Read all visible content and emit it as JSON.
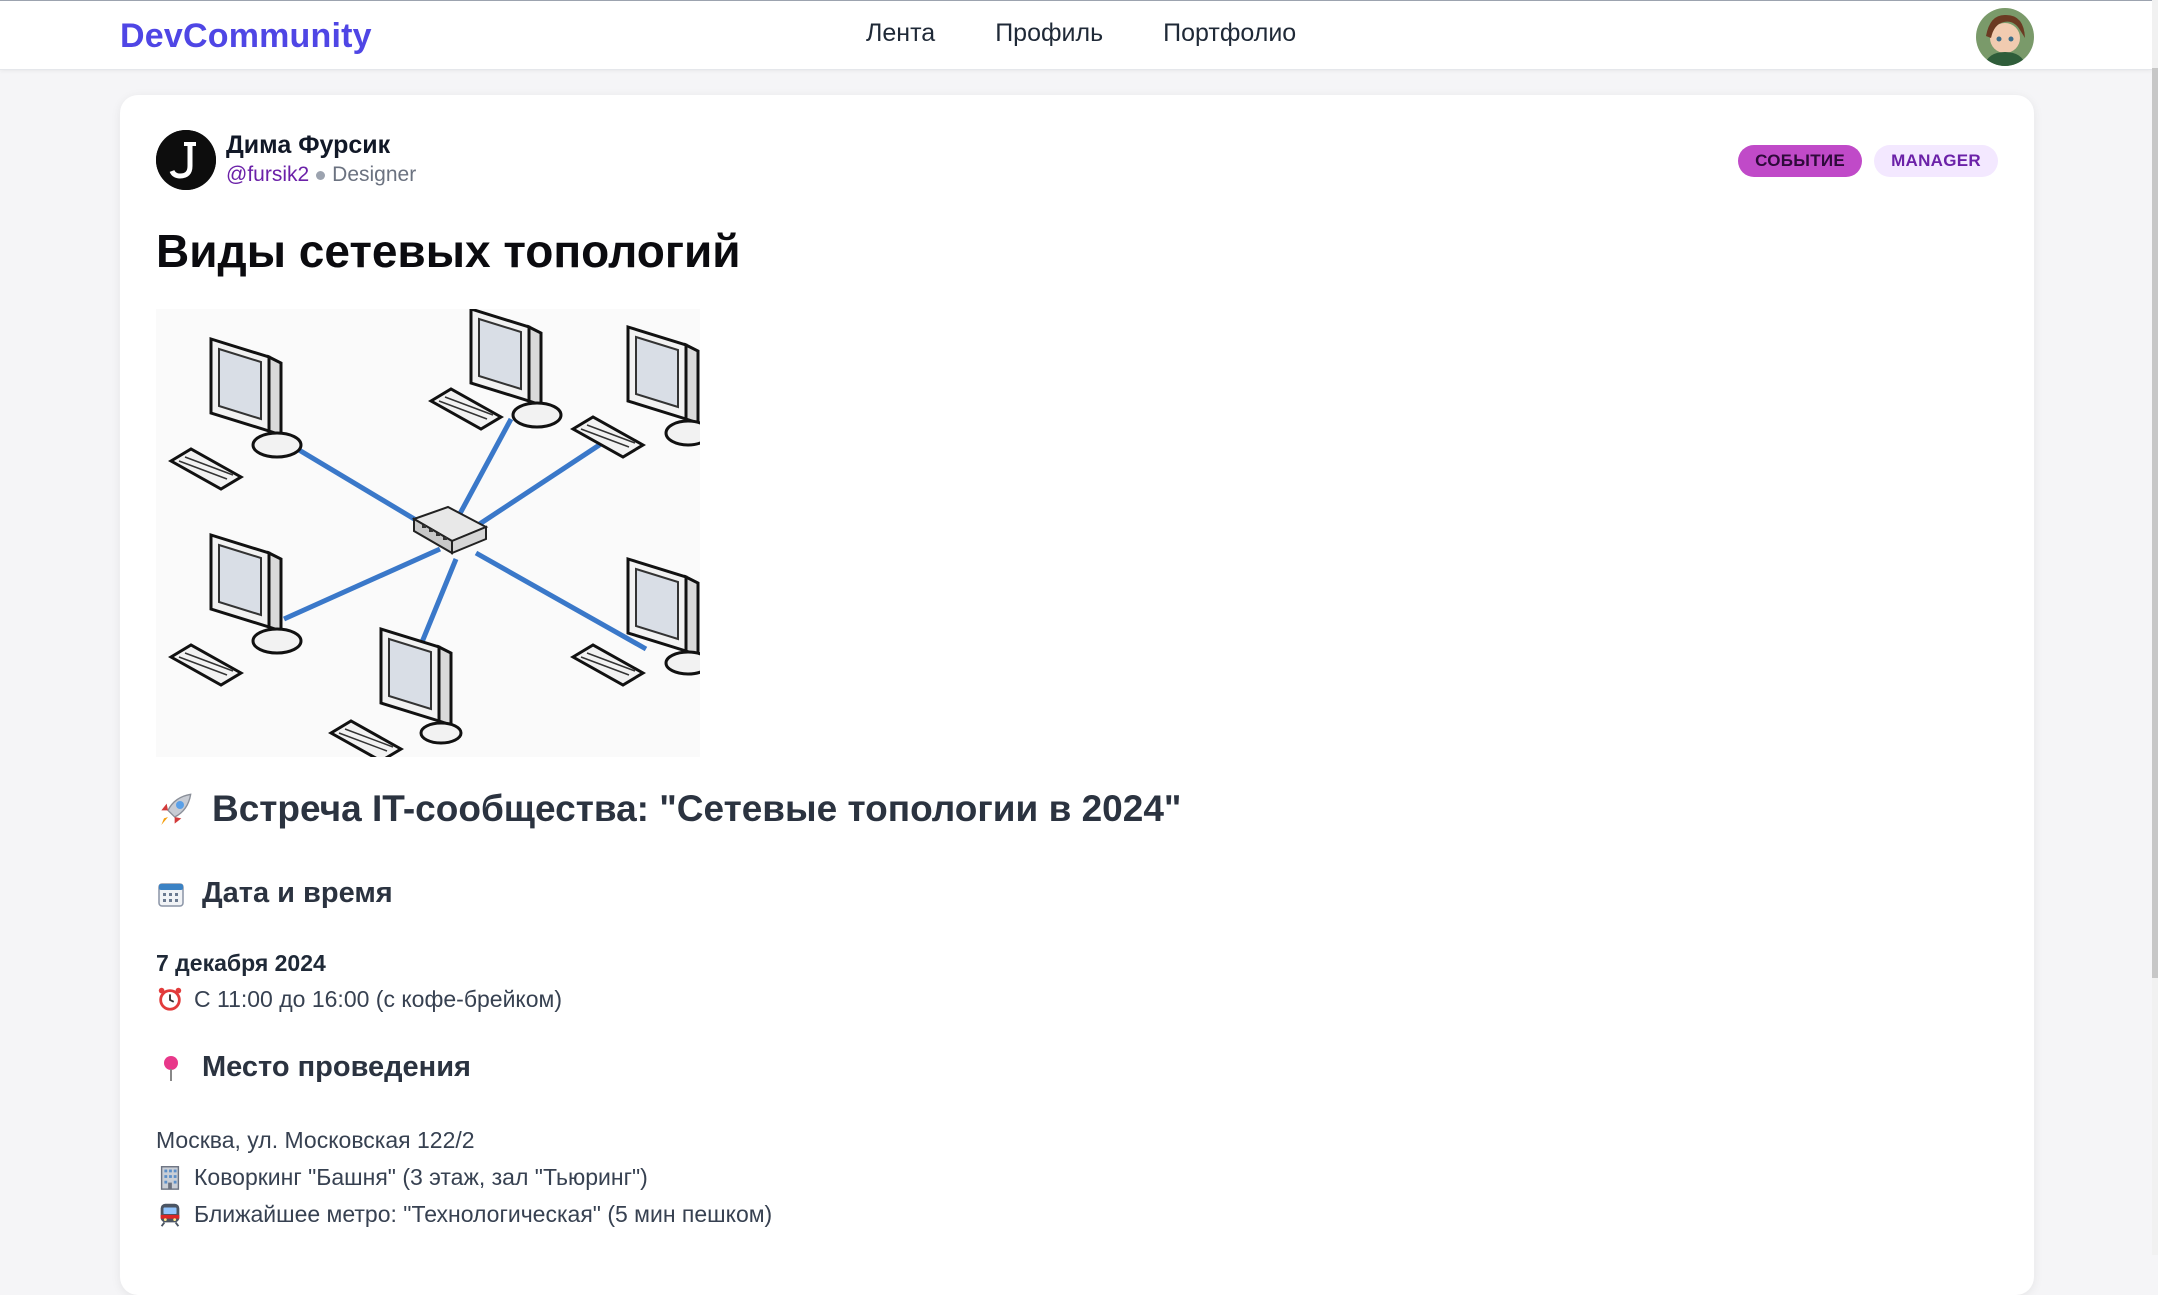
{
  "header": {
    "brand": "DevCommunity",
    "nav": [
      "Лента",
      "Профиль",
      "Портфолио"
    ]
  },
  "post": {
    "author": {
      "name": "Дима Фурсик",
      "handle": "@fursik2",
      "role": "Designer"
    },
    "badges": [
      "СОБЫТИЕ",
      "MANAGER"
    ],
    "title": "Виды сетевых топологий",
    "image_icon": "star-topology-network-diagram",
    "content": {
      "heading": "Встреча IT-сообщества: \"Сетевые топологии в 2024\"",
      "date_section": {
        "heading": "Дата и время",
        "date": "7 декабря 2024",
        "time": "С 11:00 до 16:00 (с кофе-брейком)"
      },
      "place_section": {
        "heading": "Место проведения",
        "address": "Москва, ул. Московская 122/2",
        "venue": "Коворкинг \"Башня\" (3 этаж, зал \"Тьюринг\")",
        "metro": "Ближайшее метро: \"Технологическая\" (5 мин пешком)"
      }
    }
  },
  "colors": {
    "brand": "#4f46e5",
    "badge_event": "#c04ac8",
    "badge_role_bg": "#f3e8ff",
    "link": "#1e6fd9"
  },
  "icons": [
    "rocket-icon",
    "calendar-icon",
    "alarm-clock-icon",
    "pushpin-icon",
    "office-building-icon",
    "metro-icon"
  ]
}
